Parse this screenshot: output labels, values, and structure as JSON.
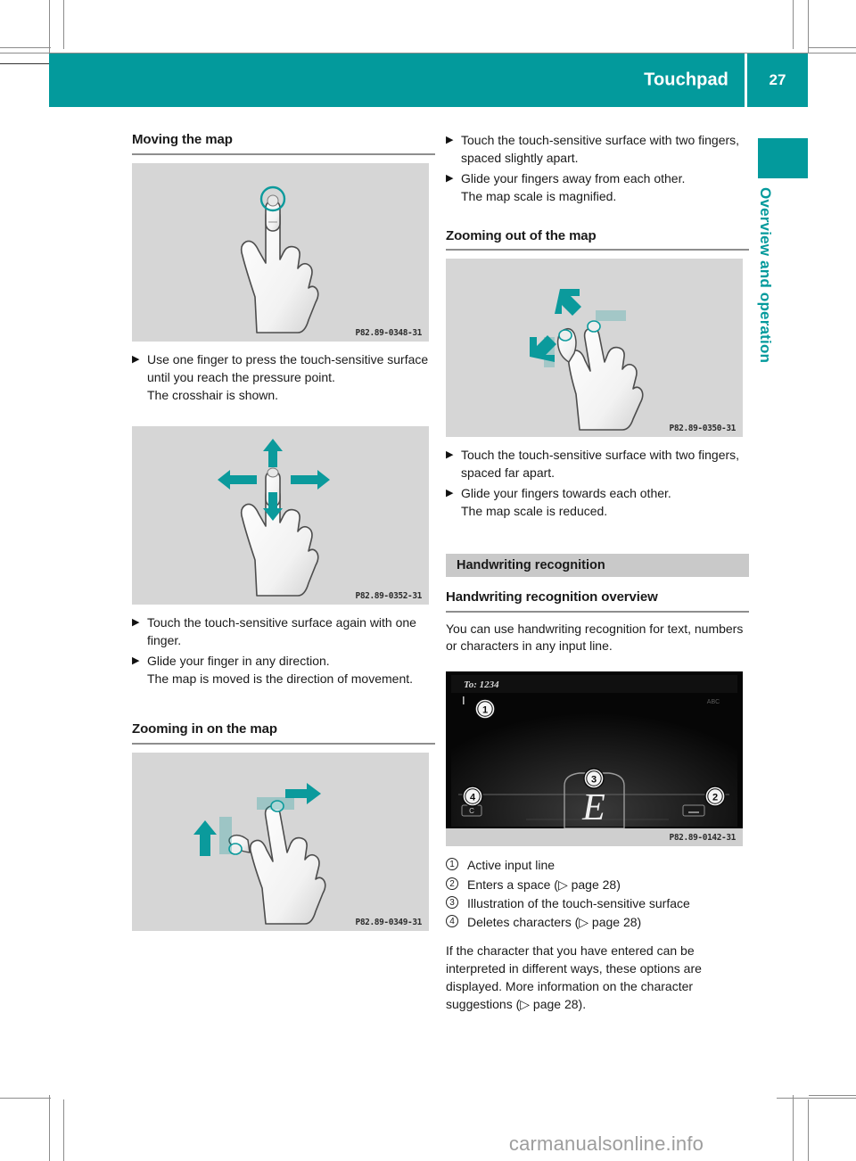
{
  "header": {
    "title": "Touchpad",
    "page_number": "27"
  },
  "side_tab": {
    "label": "Overview and operation"
  },
  "left_column": {
    "heading_moving": "Moving the map",
    "figure_press": {
      "code": "P82.89-0348-31",
      "alt": "hand pressing touchpad with one finger and crosshair"
    },
    "bullets_press": [
      "Use one finger to press the touch-sensitive surface until you reach the pressure point. The crosshair is shown.",
      ""
    ],
    "bullet_press_1": "Use one finger to press the touch-sensitive",
    "figure_glide": {
      "code": "P82.89-0352-31",
      "alt": "hand gliding one finger in four directions"
    },
    "bullet_touch_again": "Touch the touch-sensitive surface again with one finger.",
    "bullet_glide": "Glide your finger in any direction.",
    "bullet_glide_result": "The map is moved is the direction of movement.",
    "bullet_press_text": "Use one finger to press the touch-sensitive surface until you reach the pressure point.",
    "bullet_press_result": "The crosshair is shown.",
    "heading_zoom_in": "Zooming in on the map",
    "figure_zoom_in": {
      "code": "P82.89-0349-31",
      "alt": "two fingers spreading apart to zoom in"
    }
  },
  "right_column": {
    "bullet_touch_two": "Touch the touch-sensitive surface with two fingers, spaced slightly apart.",
    "bullet_glide_away": "Glide your fingers away from each other.",
    "bullet_glide_away_result": "The map scale is magnified.",
    "heading_zoom_out": "Zooming out of the map",
    "figure_zoom_out": {
      "code": "P82.89-0350-31",
      "alt": "two fingers pinching together to zoom out"
    },
    "bullet_touch_far": "Touch the touch-sensitive surface with two fingers, spaced far apart.",
    "bullet_glide_towards": "Glide your fingers towards each other.",
    "bullet_glide_towards_result": "The map scale is reduced.",
    "grey_heading": "Handwriting recognition",
    "heading_overview": "Handwriting recognition overview",
    "para_overview": "You can use handwriting recognition for text, numbers or characters in any input line.",
    "figure_screen": {
      "code": "P82.89-0142-31",
      "input_line_label": "To:",
      "input_line_value": "1234",
      "corner_label": "ABC",
      "drawn_character": "E",
      "callouts": [
        "1",
        "2",
        "3",
        "4"
      ],
      "left_key_glyph": "C",
      "right_key_glyph": "␣"
    },
    "legend": [
      {
        "num": "1",
        "text": "Active input line"
      },
      {
        "num": "2",
        "text": "Enters a space (",
        "page_ref": "page 28",
        "suffix": ")"
      },
      {
        "num": "3",
        "text": "Illustration of the touch-sensitive surface",
        "page_ref": "",
        "suffix": ""
      },
      {
        "num": "4",
        "text": "Deletes characters (",
        "page_ref": "page 28",
        "suffix": ")"
      }
    ],
    "legend_1_text": "Active input line",
    "legend_2_text": "Enters a space (▷ page 28)",
    "legend_3_text": "Illustration of the touch-sensitive surface",
    "legend_4_text": "Deletes characters (▷ page 28)",
    "para_closing": "If the character that you have entered can be interpreted in different ways, these options are displayed. More information on the character suggestions (▷ page 28)."
  },
  "bullet_marker": "▶",
  "watermark": "carmanualsonline.info",
  "colors": {
    "teal": "#039a9c",
    "figure_bg": "#d6d6d6",
    "grey_heading_bg": "#c9c9c9",
    "screen_bg": "#050505"
  }
}
